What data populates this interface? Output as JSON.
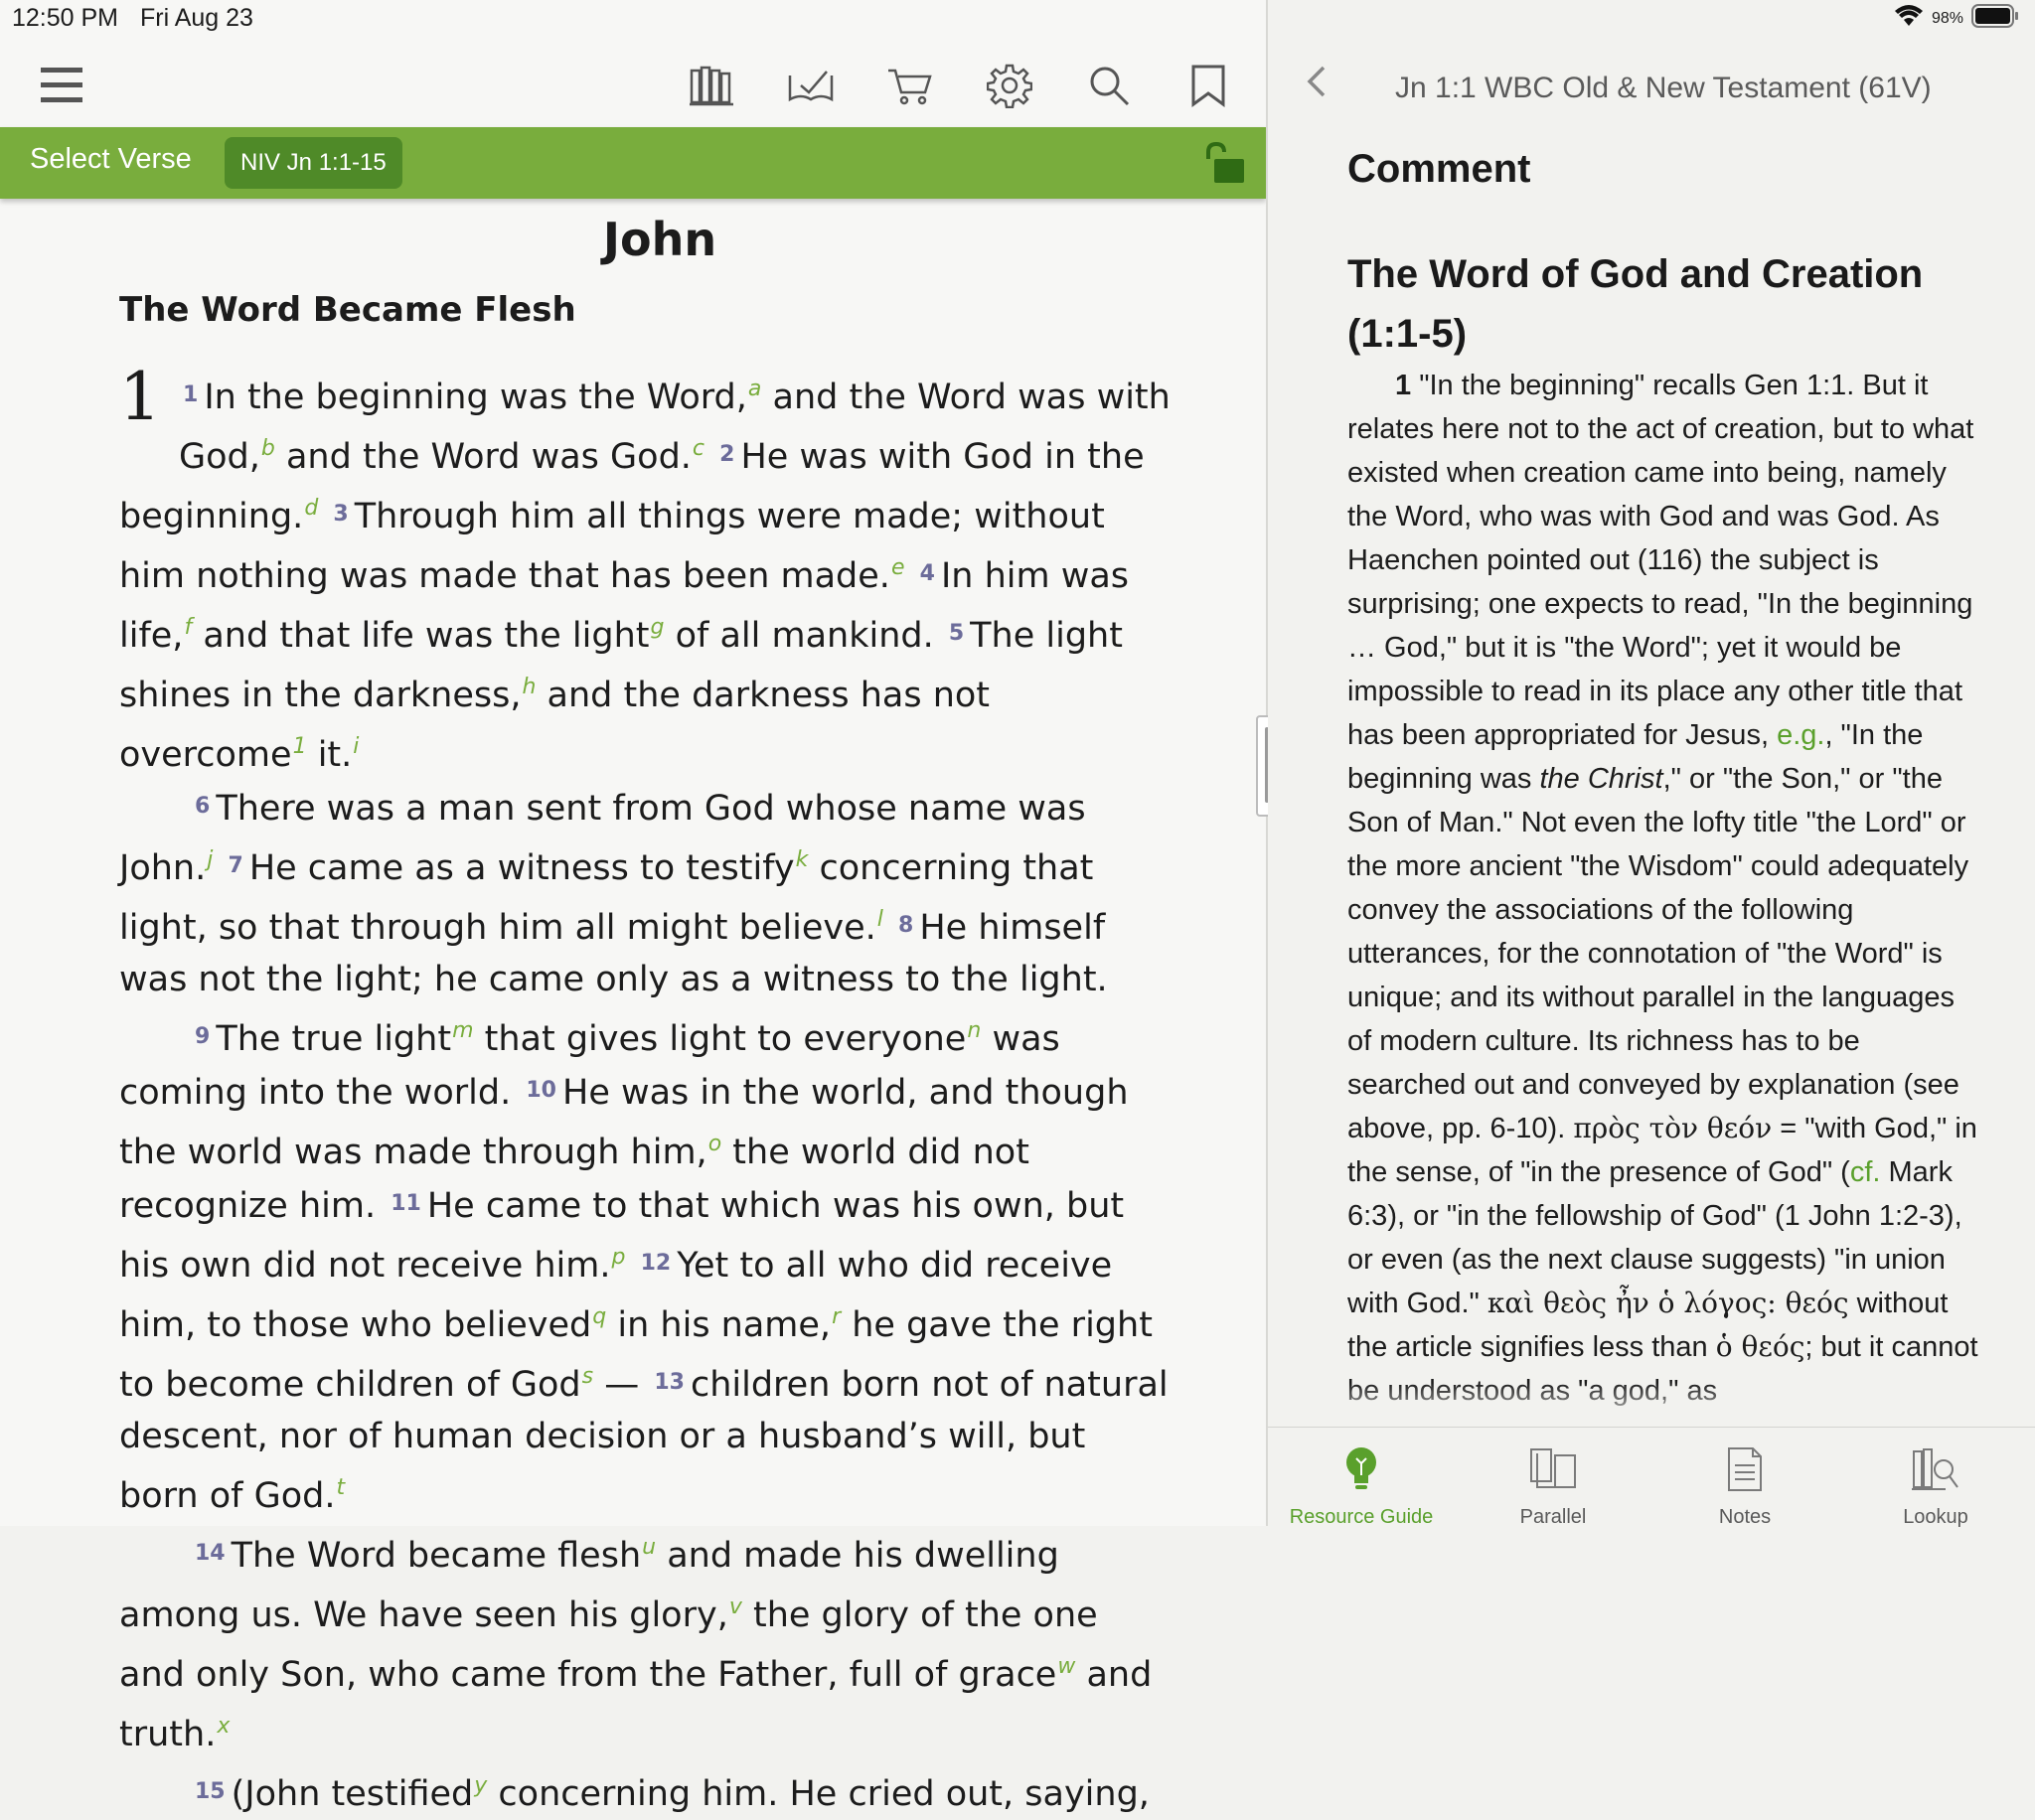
{
  "status_bar": {
    "time": "12:50 PM",
    "date": "Fri Aug 23",
    "battery": "98%"
  },
  "toolbar": {
    "icons": [
      "hamburger-menu-icon",
      "library-icon",
      "reading-plan-icon",
      "cart-icon",
      "settings-gear-icon",
      "search-icon",
      "bookmark-icon"
    ]
  },
  "verse_bar": {
    "select_label": "Select Verse",
    "reference": "NIV Jn 1:1-15",
    "lock_state": "unlocked"
  },
  "bible": {
    "book_title": "John",
    "section_heading": "The Word Became Flesh",
    "chapter": "1",
    "v1": "In the beginning was the Word,",
    "f_a": "a",
    "v1b": " and the Word was with God,",
    "f_b": "b",
    "v1c": " and the Word was God.",
    "f_c": "c",
    "v2": "He was with God in the be­ginning.",
    "f_d": "d",
    "v3": "Through him all things were made; without him noth­ing was made that has been made.",
    "f_e": "e",
    "v4": "In him was life,",
    "f_f": "f",
    "v4b": " and that life was the light",
    "f_g": "g",
    "v4c": " of all mankind.",
    "v5": "The light shines in the dark­ness,",
    "f_h": "h",
    "v5b": " and the darkness has not overcome",
    "f_1": "1",
    "v5c": " it.",
    "f_i": "i",
    "v6": "There was a man sent from God whose name was John.",
    "f_j": "j",
    "v7": "He came as a witness to testify",
    "f_k": "k",
    "v7b": " concerning that light, so that through him all might believe.",
    "f_l": "l",
    "v8": "He himself was not the light; he came only as a witness to the light.",
    "v9": "The true light",
    "f_m": "m",
    "v9b": " that gives light to everyone",
    "f_n": "n",
    "v9c": " was coming into the world.",
    "v10": "He was in the world, and though the world was made through him,",
    "f_o": "o",
    "v10b": " the world did not recognize him.",
    "v11": "He came to that which was his own, but his own did not receive him.",
    "f_p": "p",
    "v12": "Yet to all who did receive him, to those who believed",
    "f_q": "q",
    "v12b": " in his name,",
    "f_r": "r",
    "v12c": " he gave the right to become children of God",
    "f_s": "s",
    "v12d": " —",
    "v13": "children born not of natural descent, nor of human decision or a husband’s will, but born of God.",
    "f_t": "t",
    "v14": "The Word became flesh",
    "f_u": "u",
    "v14b": " and made his dwelling among us. We have seen his glory,",
    "f_v": "v",
    "v14c": " the glory of the one and only Son, who came from the Father, full of grace",
    "f_w": "w",
    "v14d": " and truth.",
    "f_x": "x",
    "v15": "(John testified",
    "f_y": "y",
    "v15b": " concerning him. He cried out, saying,",
    "verse_numbers": [
      "1",
      "2",
      "3",
      "4",
      "5",
      "6",
      "7",
      "8",
      "9",
      "10",
      "11",
      "12",
      "13",
      "14",
      "15"
    ]
  },
  "commentary": {
    "header_title": "Jn 1:1 WBC Old & New Testament (61V)",
    "comment_heading": "Comment",
    "section_heading": "The Word of God and Creation (1:1-5)",
    "lead": "1",
    "p1": " \"In the beginning\" recalls Gen 1:1. But it relates here not to the act of creation, but to what existed when creation came into being, namely the Word, who was with God and was God. As Haenchen pointed out (116) the sub­ject is surprising; one expects to read, \"In the beginning … God,\" but it is \"the Word\"; yet it would be impossible to read in its place any other title that has been appropriated for Je­sus, ",
    "eg": "e.g.",
    "p2": ", \"In the beginning was ",
    "p2_italic": "the Christ",
    "p3": ",\" or \"the Son,\" or \"the Son of Man.\" Not even the lofty title \"the Lord\" or the more ancient \"the Wisdom\" could adequately convey the associ­ations of the following utterances, for the connotation of \"the Word\" is unique; and its without parallel in the languages of modern culture. Its richness has to be searched out and conveyed by explanation (see above, pp. 6-10). ",
    "greek1": "πρὸς τὸν θεόν",
    "p4": " = \"with God,\" in the sense, of \"in the presence of God\" (",
    "cf": "cf.",
    "p5": " Mark 6:3), or \"in the fellowship of God\" (1 John 1:2-3), or even (as the next clause suggests) \"in union with God.\" ",
    "greek2": "καὶ θεὸς ἦν ὁ λόγος: θεός",
    "p6": " without the article signifies less than ",
    "greek3": "ὁ θεός",
    "p7": "; but it cannot be understood as \"a god,\" as"
  },
  "tabs": [
    {
      "label": "Resource Guide",
      "icon": "lightbulb-icon",
      "active": true
    },
    {
      "label": "Parallel",
      "icon": "parallel-books-icon",
      "active": false
    },
    {
      "label": "Notes",
      "icon": "notes-icon",
      "active": false
    },
    {
      "label": "Lookup",
      "icon": "lookup-icon",
      "active": false
    }
  ],
  "colors": {
    "accent_green": "#79ad3d",
    "pill_green": "#4f8a28",
    "verse_number": "#6c6c9a"
  }
}
